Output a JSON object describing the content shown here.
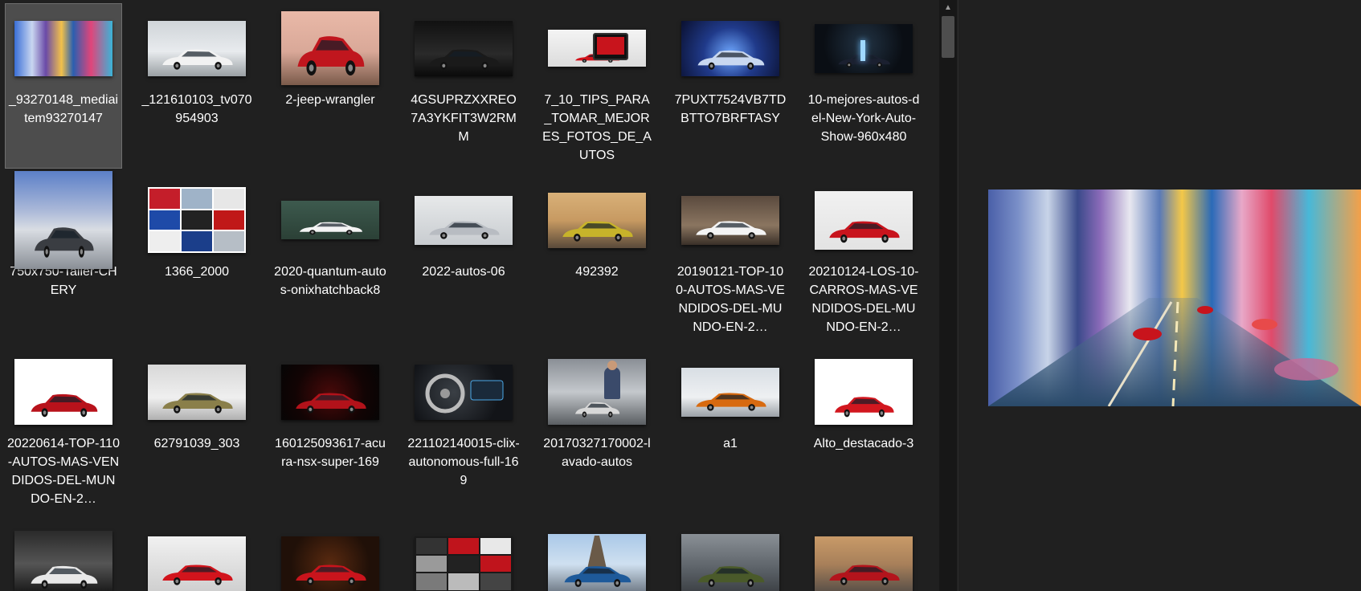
{
  "files": [
    {
      "name": "_93270148_mediaitem93270147",
      "selected": true,
      "theme": "city-lights"
    },
    {
      "name": "_121610103_tv070954903",
      "theme": "white-sedan"
    },
    {
      "name": "2-jeep-wrangler",
      "theme": "red-jeep"
    },
    {
      "name": "4GSUPRZXXREO7A3YKFIT3W2RMM",
      "theme": "black-hyper"
    },
    {
      "name": "7_10_TIPS_PARA_TOMAR_MEJORES_FOTOS_DE_AUTOS",
      "theme": "phone-photo"
    },
    {
      "name": "7PUXT7524VB7TDBTTO7BRFTASY",
      "theme": "concept-car"
    },
    {
      "name": "10-mejores-autos-del-New-York-Auto-Show-960x480",
      "theme": "dark-front"
    },
    {
      "name": "750x750-Taller-CHERY",
      "theme": "chery-ad"
    },
    {
      "name": "1366_2000",
      "theme": "collage"
    },
    {
      "name": "2020-quantum-autos-onixhatchback8",
      "theme": "white-hatch"
    },
    {
      "name": "2022-autos-06",
      "theme": "silver-sedan"
    },
    {
      "name": "492392",
      "theme": "yellow-hyper"
    },
    {
      "name": "20190121-TOP-100-AUTOS-MAS-VENDIDOS-DEL-MUNDO-EN-2…",
      "theme": "white-corolla"
    },
    {
      "name": "20210124-LOS-10-CARROS-MAS-VENDIDOS-DEL-MUNDO-EN-2…",
      "theme": "red-sedan"
    },
    {
      "name": "20220614-TOP-110-AUTOS-MAS-VENDIDOS-DEL-MUNDO-EN-2…",
      "theme": "red-suv"
    },
    {
      "name": "62791039_303",
      "theme": "gold-lambo"
    },
    {
      "name": "160125093617-acura-nsx-super-169",
      "theme": "red-nsx"
    },
    {
      "name": "221102140015-clix-autonomous-full-169",
      "theme": "dashboard"
    },
    {
      "name": "20170327170002-lavado-autos",
      "theme": "car-wash"
    },
    {
      "name": "a1",
      "theme": "orange-charger"
    },
    {
      "name": "Alto_destacado-3",
      "theme": "red-alto"
    },
    {
      "name": "",
      "theme": "maserati"
    },
    {
      "name": "",
      "theme": "ferrari-f40"
    },
    {
      "name": "",
      "theme": "red-lambo-night"
    },
    {
      "name": "",
      "theme": "collage2"
    },
    {
      "name": "",
      "theme": "bugatti-paris"
    },
    {
      "name": "",
      "theme": "green-lambo"
    },
    {
      "name": "",
      "theme": "red-tesla"
    }
  ],
  "preview": {
    "theme": "city-lights"
  },
  "scrollbar": {
    "up_arrow": "▲"
  }
}
